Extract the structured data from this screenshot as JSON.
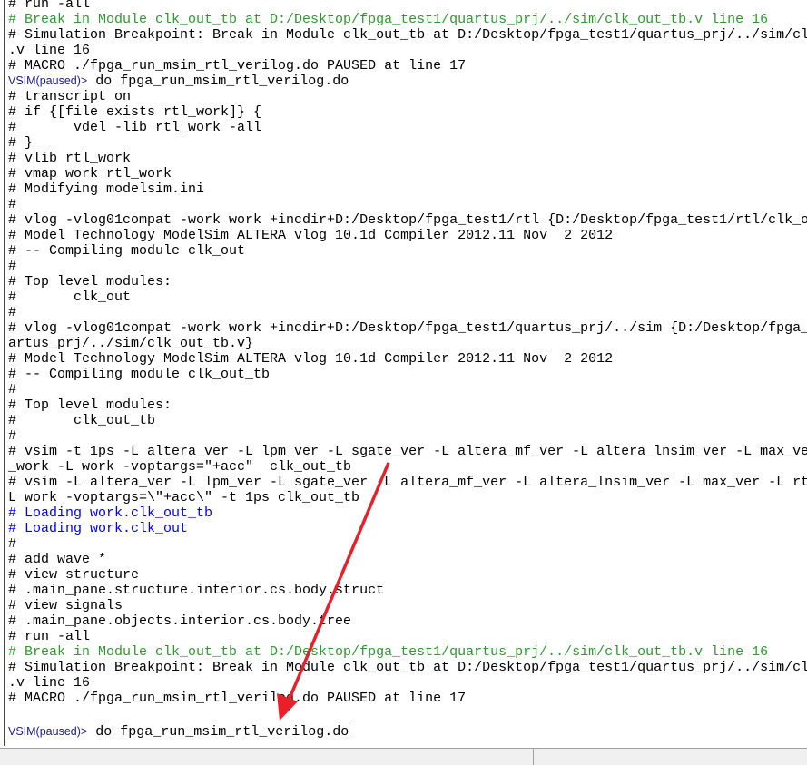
{
  "transcript": {
    "lines": [
      {
        "text": "# run -all",
        "color": "black"
      },
      {
        "text": "# Break in Module clk_out_tb at D:/Desktop/fpga_test1/quartus_prj/../sim/clk_out_tb.v line 16",
        "color": "green"
      },
      {
        "text": "# Simulation Breakpoint: Break in Module clk_out_tb at D:/Desktop/fpga_test1/quartus_prj/../sim/clk",
        "color": "black"
      },
      {
        "text": ".v line 16",
        "color": "black"
      },
      {
        "text": "# MACRO ./fpga_run_msim_rtl_verilog.do PAUSED at line 17",
        "color": "black"
      },
      {
        "text": "VSIM(paused)> do fpga_run_msim_rtl_verilog.do",
        "color": "prompt"
      },
      {
        "text": "# transcript on",
        "color": "black"
      },
      {
        "text": "# if {[file exists rtl_work]} {",
        "color": "black"
      },
      {
        "text": "#       vdel -lib rtl_work -all",
        "color": "black"
      },
      {
        "text": "# }",
        "color": "black"
      },
      {
        "text": "# vlib rtl_work",
        "color": "black"
      },
      {
        "text": "# vmap work rtl_work",
        "color": "black"
      },
      {
        "text": "# Modifying modelsim.ini",
        "color": "black"
      },
      {
        "text": "#",
        "color": "black"
      },
      {
        "text": "# vlog -vlog01compat -work work +incdir+D:/Desktop/fpga_test1/rtl {D:/Desktop/fpga_test1/rtl/clk_o",
        "color": "black"
      },
      {
        "text": "# Model Technology ModelSim ALTERA vlog 10.1d Compiler 2012.11 Nov  2 2012",
        "color": "black"
      },
      {
        "text": "# -- Compiling module clk_out",
        "color": "black"
      },
      {
        "text": "#",
        "color": "black"
      },
      {
        "text": "# Top level modules:",
        "color": "black"
      },
      {
        "text": "#       clk_out",
        "color": "black"
      },
      {
        "text": "#",
        "color": "black"
      },
      {
        "text": "# vlog -vlog01compat -work work +incdir+D:/Desktop/fpga_test1/quartus_prj/../sim {D:/Desktop/fpga_",
        "color": "black"
      },
      {
        "text": "artus_prj/../sim/clk_out_tb.v}",
        "color": "black"
      },
      {
        "text": "# Model Technology ModelSim ALTERA vlog 10.1d Compiler 2012.11 Nov  2 2012",
        "color": "black"
      },
      {
        "text": "# -- Compiling module clk_out_tb",
        "color": "black"
      },
      {
        "text": "#",
        "color": "black"
      },
      {
        "text": "# Top level modules:",
        "color": "black"
      },
      {
        "text": "#       clk_out_tb",
        "color": "black"
      },
      {
        "text": "#",
        "color": "black"
      },
      {
        "text": "# vsim -t 1ps -L altera_ver -L lpm_ver -L sgate_ver -L altera_mf_ver -L altera_lnsim_ver -L max_ve",
        "color": "black"
      },
      {
        "text": "_work -L work -voptargs=\"+acc\"  clk_out_tb",
        "color": "black"
      },
      {
        "text": "# vsim -L altera_ver -L lpm_ver -L sgate_ver -L altera_mf_ver -L altera_lnsim_ver -L max_ver -L rt",
        "color": "black"
      },
      {
        "text": "L work -voptargs=\\\"+acc\\\" -t 1ps clk_out_tb",
        "color": "black"
      },
      {
        "text": "# Loading work.clk_out_tb",
        "color": "blue"
      },
      {
        "text": "# Loading work.clk_out",
        "color": "blue"
      },
      {
        "text": "#",
        "color": "black"
      },
      {
        "text": "# add wave *",
        "color": "black"
      },
      {
        "text": "# view structure",
        "color": "black"
      },
      {
        "text": "# .main_pane.structure.interior.cs.body.struct",
        "color": "black"
      },
      {
        "text": "# view signals",
        "color": "black"
      },
      {
        "text": "# .main_pane.objects.interior.cs.body.tree",
        "color": "black"
      },
      {
        "text": "# run -all",
        "color": "black"
      },
      {
        "text": "# Break in Module clk_out_tb at D:/Desktop/fpga_test1/quartus_prj/../sim/clk_out_tb.v line 16",
        "color": "green"
      },
      {
        "text": "# Simulation Breakpoint: Break in Module clk_out_tb at D:/Desktop/fpga_test1/quartus_prj/../sim/clk",
        "color": "black"
      },
      {
        "text": ".v line 16",
        "color": "black"
      },
      {
        "text": "# MACRO ./fpga_run_msim_rtl_verilog.do PAUSED at line 17",
        "color": "black"
      }
    ],
    "prompt": {
      "label": "VSIM(paused)>",
      "command": " do fpga_run_msim_rtl_verilog.do"
    }
  },
  "colors": {
    "green": "#2e9a2e",
    "blue": "#0000ff",
    "prompt": "#1a1a8c",
    "arrow": "#e8202a"
  }
}
